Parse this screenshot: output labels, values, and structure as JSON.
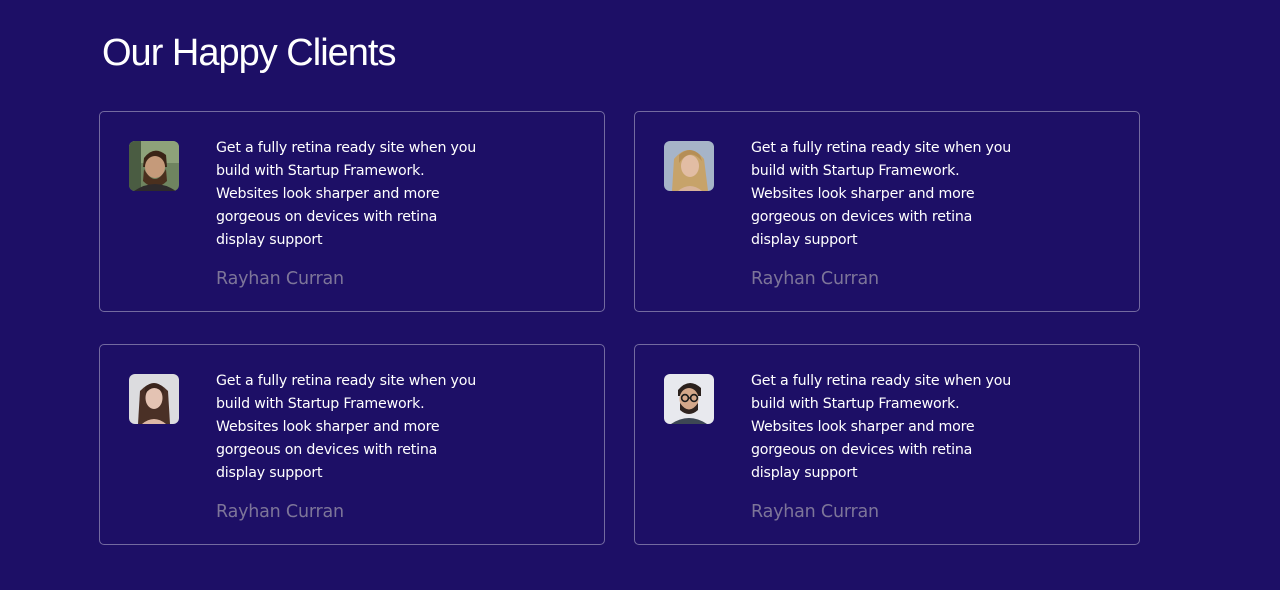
{
  "section": {
    "title": "Our Happy Clients"
  },
  "testimonials": [
    {
      "quote": "Get a fully retina ready site when you build with Startup Framework. Websites look sharper and more gorgeous on devices with retina display support",
      "author": "Rayhan Curran",
      "avatar": "bearded-man-photo"
    },
    {
      "quote": "Get a fully retina ready site when you build with Startup Framework. Websites look sharper and more gorgeous on devices with retina display support",
      "author": "Rayhan Curran",
      "avatar": "blonde-woman-photo"
    },
    {
      "quote": "Get a fully retina ready site when you build with Startup Framework. Websites look sharper and more gorgeous on devices with retina display support",
      "author": "Rayhan Curran",
      "avatar": "dark-haired-woman-photo"
    },
    {
      "quote": "Get a fully retina ready site when you build with Startup Framework. Websites look sharper and more gorgeous on devices with retina display support",
      "author": "Rayhan Curran",
      "avatar": "man-with-glasses-photo"
    }
  ],
  "colors": {
    "background": "#1d0f66",
    "text": "#ffffff",
    "author": "#7d7599",
    "card_border": "rgba(255,255,255,0.38)"
  }
}
